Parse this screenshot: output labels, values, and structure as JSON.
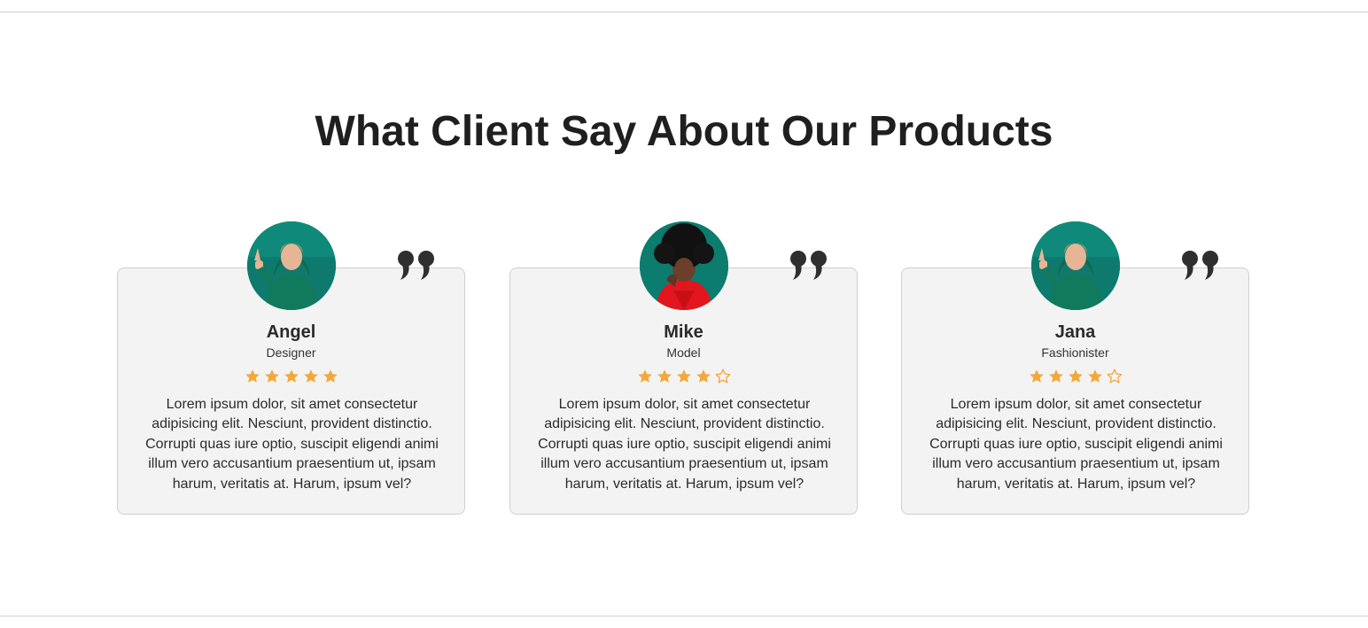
{
  "heading": "What Client Say About Our Products",
  "colors": {
    "star": "#f3a83b",
    "card_bg": "#f3f3f3",
    "quote": "#2f2f2f",
    "avatar_bg": "#0b7c6e"
  },
  "testimonials": [
    {
      "name": "Angel",
      "role": "Designer",
      "rating": 5,
      "max_rating": 5,
      "avatar_icon": "woman-green-hoodie-avatar",
      "text": "Lorem ipsum dolor, sit amet consectetur adipisicing elit. Nesciunt, provident distinctio. Corrupti quas iure optio, suscipit eligendi animi illum vero accusantium praesentium ut, ipsam harum, veritatis at. Harum, ipsum vel?"
    },
    {
      "name": "Mike",
      "role": "Model",
      "rating": 4,
      "max_rating": 5,
      "avatar_icon": "man-afro-red-hoodie-avatar",
      "text": "Lorem ipsum dolor, sit amet consectetur adipisicing elit. Nesciunt, provident distinctio. Corrupti quas iure optio, suscipit eligendi animi illum vero accusantium praesentium ut, ipsam harum, veritatis at. Harum, ipsum vel?"
    },
    {
      "name": "Jana",
      "role": "Fashionister",
      "rating": 4,
      "max_rating": 5,
      "avatar_icon": "woman-green-hoodie-avatar",
      "text": "Lorem ipsum dolor, sit amet consectetur adipisicing elit. Nesciunt, provident distinctio. Corrupti quas iure optio, suscipit eligendi animi illum vero accusantium praesentium ut, ipsam harum, veritatis at. Harum, ipsum vel?"
    }
  ]
}
